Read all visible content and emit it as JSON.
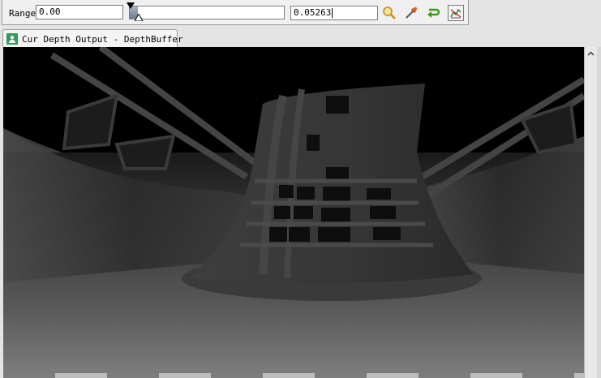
{
  "toolbar": {
    "range_label": "Range",
    "range_min": "0.00",
    "range_max": "0.05263",
    "slider_fraction": 0.05263,
    "icons": [
      "zoom-icon",
      "eyedropper-icon",
      "reset-icon",
      "auto-fit-icon"
    ]
  },
  "tab": {
    "label": "Cur Depth Output - DepthBuffer",
    "icon": "user-icon"
  },
  "colors": {
    "tab_icon": "#2f9a5a",
    "slider_fill": "#6c7d96"
  }
}
